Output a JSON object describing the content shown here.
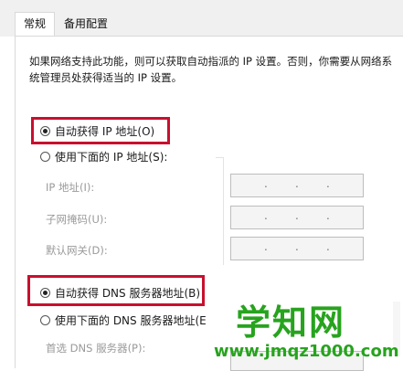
{
  "tabs": [
    {
      "label": "常规",
      "active": true
    },
    {
      "label": "备用配置",
      "active": false
    }
  ],
  "description": "如果网络支持此功能，则可以获取自动指派的 IP 设置。否则，你需要从网络系统管理员处获得适当的 IP 设置。",
  "ip_section": {
    "auto_label": "自动获得 IP 地址(O)",
    "manual_label": "使用下面的 IP 地址(S):",
    "fields": [
      {
        "label": "IP 地址(I):",
        "value": ".       .       ."
      },
      {
        "label": "子网掩码(U):",
        "value": ".       .       ."
      },
      {
        "label": "默认网关(D):",
        "value": ".       .       ."
      }
    ]
  },
  "dns_section": {
    "auto_label": "自动获得 DNS 服务器地址(B)",
    "manual_label": "使用下面的 DNS 服务器地址(E",
    "preferred_label": "首选 DNS 服务器(P):"
  },
  "watermark": {
    "title": "学知网",
    "url": "www.jmqz1000.com"
  },
  "colors": {
    "highlight_box": "#c8102e",
    "watermark": "#27a31e"
  }
}
